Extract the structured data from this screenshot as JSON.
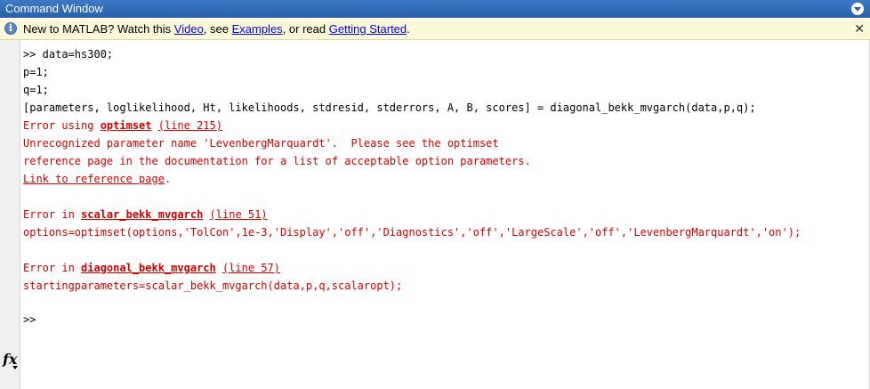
{
  "window": {
    "title": "Command Window"
  },
  "infobar": {
    "text1": "New to MATLAB? Watch this ",
    "video_link": "Video",
    "text2": ", see ",
    "examples_link": "Examples",
    "text3": ", or read ",
    "getting_started_link": "Getting Started",
    "text4": "."
  },
  "console": {
    "lines": [
      ">> data=hs300;",
      "p=1;",
      "q=1;",
      "[parameters, loglikelihood, Ht, likelihoods, stdresid, stderrors, A, B, scores] = diagonal_bekk_mvgarch(data,p,q);"
    ],
    "error1": {
      "prefix": "Error using ",
      "func": "optimset",
      "line_link": "(line 215)",
      "msg1": "Unrecognized parameter name 'LevenbergMarquardt'.  Please see the optimset",
      "msg2": "reference page in the documentation for a list of acceptable option parameters.",
      "ref_link": "Link to reference page",
      "ref_suffix": "."
    },
    "error2": {
      "prefix": "Error in ",
      "func": "scalar_bekk_mvgarch",
      "line_link": "(line 51)",
      "code": "options=optimset(options,'TolCon',1e-3,'Display','off','Diagnostics','off','LargeScale','off','LevenbergMarquardt','on');"
    },
    "error3": {
      "prefix": "Error in ",
      "func": "diagonal_bekk_mvgarch",
      "line_link": "(line 57)",
      "code": "startingparameters=scalar_bekk_mvgarch(data,p,q,scalaropt);"
    },
    "prompt": ">>"
  },
  "icons": {
    "fx": "fx"
  }
}
